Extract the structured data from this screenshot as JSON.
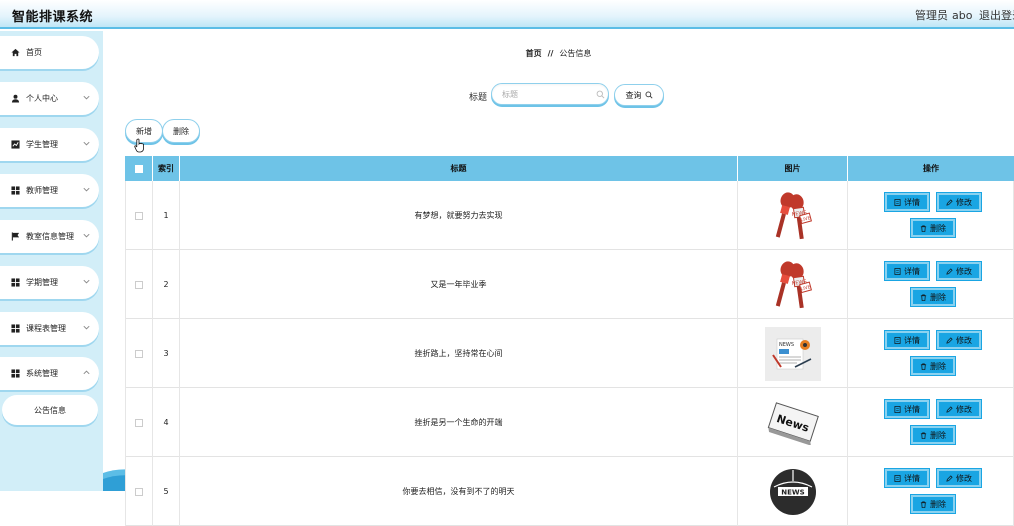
{
  "app": {
    "title": "智能排课系统",
    "admin_label": "管理员",
    "admin_name": "abo",
    "logout_label": "退出登录"
  },
  "sidebar": {
    "items": [
      {
        "label": "首页",
        "icon": "home-icon"
      },
      {
        "label": "个人中心",
        "icon": "user-icon"
      },
      {
        "label": "学生管理",
        "icon": "chart-icon"
      },
      {
        "label": "教师管理",
        "icon": "grid-icon"
      },
      {
        "label": "教室信息管理",
        "icon": "flag-icon"
      },
      {
        "label": "学期管理",
        "icon": "grid-icon"
      },
      {
        "label": "课程表管理",
        "icon": "grid-icon"
      },
      {
        "label": "系统管理",
        "icon": "grid-icon"
      }
    ],
    "active_sub": "公告信息"
  },
  "breadcrumb": {
    "home": "首页",
    "separator": "//",
    "current": "公告信息"
  },
  "search": {
    "label": "标题",
    "placeholder": "标题",
    "button_label": "查询"
  },
  "toolbar": {
    "add_label": "新增",
    "delete_label": "删除"
  },
  "table": {
    "columns": [
      "索引",
      "标题",
      "图片",
      "操作"
    ],
    "rows": [
      {
        "index": "1",
        "title": "有梦想，就要努力去实现",
        "image": "microphones-image"
      },
      {
        "index": "2",
        "title": "又是一年毕业季",
        "image": "microphones-image"
      },
      {
        "index": "3",
        "title": "挫折路上，坚持常在心间",
        "image": "news-desk-image"
      },
      {
        "index": "4",
        "title": "挫折是另一个生命的开端",
        "image": "news-paper-image"
      },
      {
        "index": "5",
        "title": "你要去相信，没有到不了的明天",
        "image": "news-globe-image"
      }
    ],
    "actions": {
      "detail": "详情",
      "edit": "修改",
      "delete": "删除"
    }
  },
  "colors": {
    "accent": "#6ec3e7",
    "action_button": "#19a5e3",
    "sidebar_bg": "#d2eef8"
  }
}
